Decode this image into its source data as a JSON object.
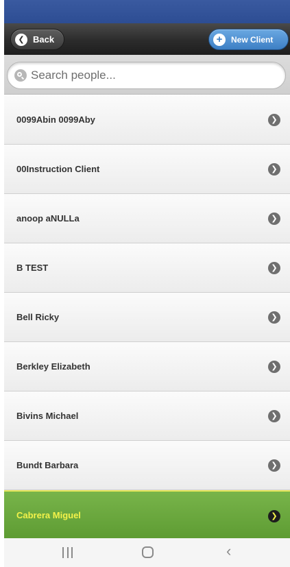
{
  "header": {
    "back_label": "Back",
    "new_client_label": "New Client"
  },
  "search": {
    "placeholder": "Search people..."
  },
  "clients": [
    {
      "name": "0099Abin 0099Aby"
    },
    {
      "name": "00Instruction Client"
    },
    {
      "name": "anoop aNULLa"
    },
    {
      "name": "B TEST"
    },
    {
      "name": "Bell Ricky"
    },
    {
      "name": "Berkley Elizabeth"
    },
    {
      "name": "Bivins Michael"
    },
    {
      "name": "Bundt Barbara"
    },
    {
      "name": "Cabrera Miguel",
      "selected": true
    }
  ],
  "icons": {
    "back": "chevron-left-circle-icon",
    "new_client": "plus-circle-icon",
    "search": "search-icon",
    "row_arrow": "chevron-right-circle-icon",
    "nav_recents": "recents-icon",
    "nav_home": "home-icon",
    "nav_back": "back-icon"
  },
  "colors": {
    "header_bar": "#2d4d93",
    "toolbar": "#2b2b2b",
    "new_client_button": "#3d7fc4",
    "selected_row": "#5e9c33",
    "selected_text": "#f3f24a"
  }
}
